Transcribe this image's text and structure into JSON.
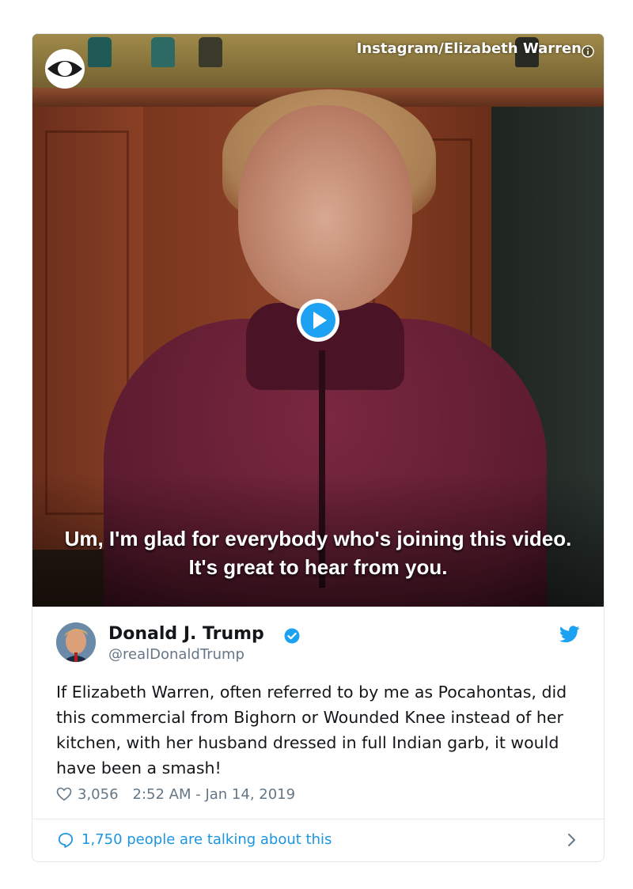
{
  "video": {
    "watermark": "Instagram/Elizabeth Warren",
    "caption_line1": "Um, I'm glad for everybody who's joining this video.",
    "caption_line2": "It's great to hear from you.",
    "logo_icon": "cbs-eye-logo",
    "play_icon": "play-circle-icon",
    "info_icon": "info-icon"
  },
  "tweet": {
    "display_name": "Donald J. Trump",
    "handle": "@realDonaldTrump",
    "verified_icon": "verified-badge-icon",
    "brand_icon": "twitter-bird-icon",
    "text": "If Elizabeth Warren, often referred to by me as Pocahontas, did this commercial from Bighorn or Wounded Knee instead of her kitchen, with her husband dressed in full Indian garb, it would have been a smash!",
    "likes": "3,056",
    "timestamp": "2:52 AM - Jan 14, 2019"
  },
  "footer": {
    "talking": "1,750 people are talking about this"
  },
  "colors": {
    "twitter_blue": "#1da1f2",
    "link_blue": "#1b95e0",
    "muted": "#657786",
    "text": "#14171a"
  }
}
